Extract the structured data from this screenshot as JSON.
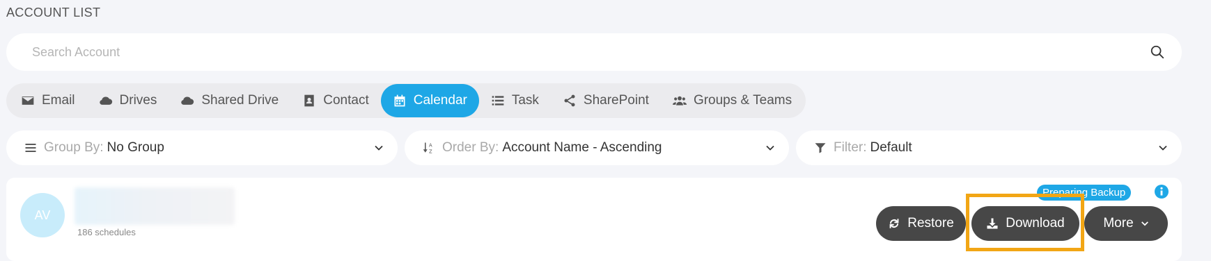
{
  "header": {
    "title": "ACCOUNT LIST"
  },
  "search": {
    "placeholder": "Search Account",
    "value": ""
  },
  "tabs": [
    {
      "label": "Email",
      "icon": "envelope-icon",
      "active": false
    },
    {
      "label": "Drives",
      "icon": "cloud-icon",
      "active": false
    },
    {
      "label": "Shared Drive",
      "icon": "cloud-icon",
      "active": false
    },
    {
      "label": "Contact",
      "icon": "contact-book-icon",
      "active": false
    },
    {
      "label": "Calendar",
      "icon": "calendar-icon",
      "active": true
    },
    {
      "label": "Task",
      "icon": "list-icon",
      "active": false
    },
    {
      "label": "SharePoint",
      "icon": "share-icon",
      "active": false
    },
    {
      "label": "Groups & Teams",
      "icon": "users-icon",
      "active": false
    }
  ],
  "filters": {
    "group_by": {
      "label": "Group By:",
      "value": "No Group"
    },
    "order_by": {
      "label": "Order By:",
      "value": "Account Name - Ascending"
    },
    "filter": {
      "label": "Filter:",
      "value": "Default"
    }
  },
  "account": {
    "initials": "AV",
    "schedules": "186 schedules",
    "status": "Preparing Backup",
    "actions": {
      "restore": "Restore",
      "download": "Download",
      "more": "More"
    }
  },
  "colors": {
    "accent": "#1ea7e6",
    "button_dark": "#474747",
    "highlight": "#f2a615"
  }
}
